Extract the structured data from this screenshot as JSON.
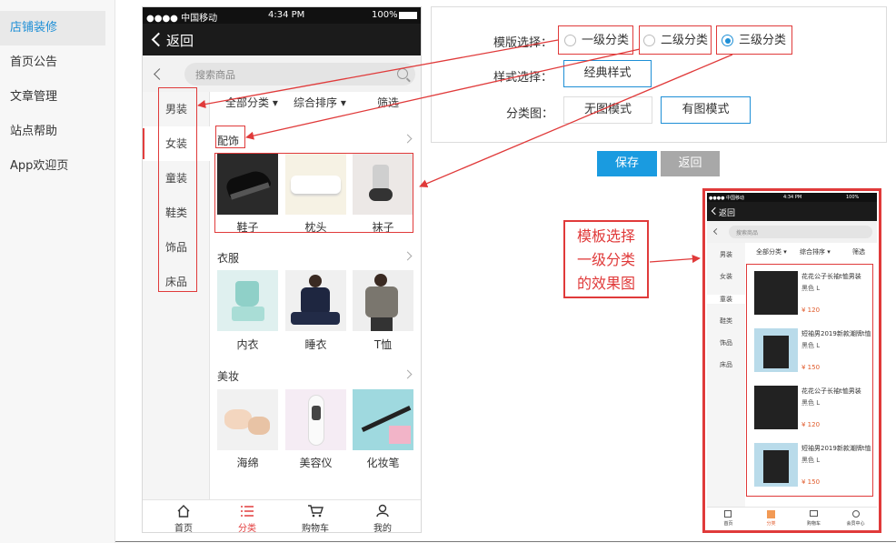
{
  "sidebar": {
    "items": [
      {
        "label": "店铺装修",
        "active": true
      },
      {
        "label": "首页公告",
        "active": false
      },
      {
        "label": "文章管理",
        "active": false
      },
      {
        "label": "站点帮助",
        "active": false
      },
      {
        "label": "App欢迎页",
        "active": false
      }
    ]
  },
  "phone": {
    "status": {
      "carrier": "●●●● 中国移动",
      "time": "4:34 PM",
      "battery": "100%"
    },
    "back_label": "返回",
    "search_placeholder": "搜索商品",
    "categories": [
      {
        "label": "男装",
        "active": false
      },
      {
        "label": "女装",
        "active": true
      },
      {
        "label": "童装",
        "active": false
      },
      {
        "label": "鞋类",
        "active": false
      },
      {
        "label": "饰品",
        "active": false
      },
      {
        "label": "床品",
        "active": false
      }
    ],
    "sort": {
      "all": "全部分类 ▾",
      "composite": "综合排序 ▾",
      "filter": "筛选"
    },
    "sections": [
      {
        "title": "配饰",
        "items": [
          "鞋子",
          "枕头",
          "袜子"
        ]
      },
      {
        "title": "衣服",
        "items": [
          "内衣",
          "睡衣",
          "T恤"
        ]
      },
      {
        "title": "美妆",
        "items": [
          "海绵",
          "美容仪",
          "化妆笔"
        ]
      }
    ],
    "tabs": [
      {
        "label": "首页",
        "icon": "home-icon",
        "active": false
      },
      {
        "label": "分类",
        "icon": "list-icon",
        "active": true
      },
      {
        "label": "购物车",
        "icon": "cart-icon",
        "active": false
      },
      {
        "label": "我的",
        "icon": "user-icon",
        "active": false
      }
    ]
  },
  "form": {
    "template_label": "模版选择：",
    "template_options": [
      {
        "label": "一级分类",
        "selected": false
      },
      {
        "label": "二级分类",
        "selected": false
      },
      {
        "label": "三级分类",
        "selected": true
      }
    ],
    "style_label": "样式选择：",
    "style_value": "经典样式",
    "image_label": "分类图：",
    "image_options": [
      {
        "label": "无图模式",
        "selected": false
      },
      {
        "label": "有图模式",
        "selected": true
      }
    ]
  },
  "buttons": {
    "save": "保存",
    "back": "返回"
  },
  "annotation": {
    "lines": [
      "模板选择",
      "一级分类",
      "的效果图"
    ]
  },
  "mini_phone": {
    "status": {
      "carrier": "●●●● 中国移动",
      "time": "4:34 PM",
      "battery": "100%"
    },
    "back_label": "返回",
    "search_placeholder": "搜索商品",
    "categories": [
      "男装",
      "女装",
      "童装",
      "鞋类",
      "饰品",
      "床品"
    ],
    "sort": {
      "all": "全部分类 ▾",
      "composite": "综合排序 ▾",
      "filter": "筛选"
    },
    "products": [
      {
        "name": "花花公子长袖t恤男装",
        "color": "黑色 L",
        "price": "¥ 120"
      },
      {
        "name": "短袖男2019新款潮牌t恤",
        "color": "黑色 L",
        "price": "¥ 150"
      },
      {
        "name": "花花公子长袖t恤男装",
        "color": "黑色 L",
        "price": "¥ 120"
      },
      {
        "name": "短袖男2019新款潮牌t恤",
        "color": "黑色 L",
        "price": "¥ 150"
      }
    ],
    "tabs": [
      "首页",
      "分类",
      "购物车",
      "会员中心"
    ]
  },
  "colors": {
    "accent": "#1e8fd6",
    "annotation_red": "#e03a3a",
    "save_button": "#1a9be0",
    "back_button": "#a8a8a8"
  }
}
